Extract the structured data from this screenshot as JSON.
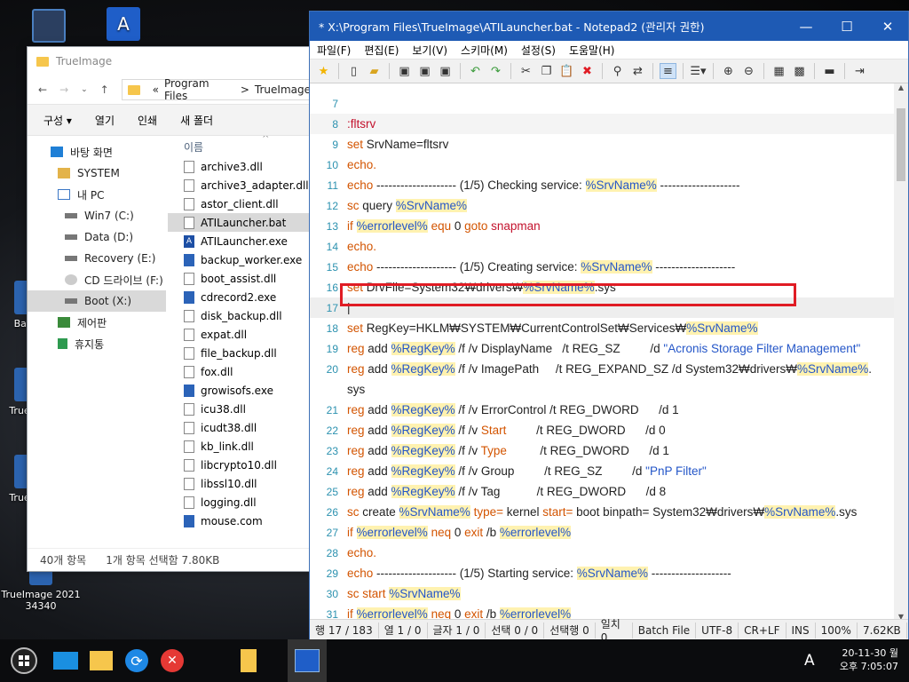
{
  "desktop": {
    "icons": [
      {
        "label": "Back"
      },
      {
        "label": "TrueIm"
      },
      {
        "label": "TrueIm"
      },
      {
        "label": "TrueImage 2021\n34340"
      }
    ]
  },
  "explorer": {
    "title": "TrueImage",
    "address": {
      "sep": "«",
      "path1": "Program Files",
      "arrow": ">",
      "path2": "TrueImage"
    },
    "commands": [
      "구성 ▾",
      "열기",
      "인쇄",
      "새 폴더"
    ],
    "nav": [
      {
        "label": "바탕 화면",
        "icon": "desktop-icon"
      },
      {
        "label": "SYSTEM",
        "icon": "user-folder-icon"
      },
      {
        "label": "내 PC",
        "icon": "computer-icon"
      },
      {
        "label": "Win7 (C:)",
        "icon": "drive-icon"
      },
      {
        "label": "Data (D:)",
        "icon": "drive-icon"
      },
      {
        "label": "Recovery (E:)",
        "icon": "drive-icon"
      },
      {
        "label": "CD 드라이브 (F:)",
        "icon": "cd-icon"
      },
      {
        "label": "Boot (X:)",
        "icon": "drive-icon"
      },
      {
        "label": "제어판",
        "icon": "control-panel-icon"
      },
      {
        "label": "휴지통",
        "icon": "recycle-bin-icon"
      }
    ],
    "column_header": "이름",
    "files": [
      "archive3.dll",
      "archive3_adapter.dll",
      "astor_client.dll",
      "ATILauncher.bat",
      "ATILauncher.exe",
      "backup_worker.exe",
      "boot_assist.dll",
      "cdrecord2.exe",
      "disk_backup.dll",
      "expat.dll",
      "file_backup.dll",
      "fox.dll",
      "growisofs.exe",
      "icu38.dll",
      "icudt38.dll",
      "kb_link.dll",
      "libcrypto10.dll",
      "libssl10.dll",
      "logging.dll",
      "mouse.com"
    ],
    "status_count": "40개 항목",
    "status_sel": "1개 항목 선택함 7.80KB"
  },
  "notepad": {
    "title": "* X:\\Program Files\\TrueImage\\ATILauncher.bat - Notepad2 (관리자 권한)",
    "menu": [
      "파일(F)",
      "편집(E)",
      "보기(V)",
      "스키마(M)",
      "설정(S)",
      "도움말(H)"
    ],
    "status": [
      "행 17 / 183",
      "열 1 / 0",
      "글자 1 / 0",
      "선택 0 / 0",
      "선택행 0",
      "일치 0",
      "Batch File",
      "UTF-8",
      "CR+LF",
      "INS",
      "100%",
      "7.62KB"
    ]
  },
  "colors": {
    "titlebar": "#1e5ab4",
    "highlight_box": "#e01c24",
    "keyword": "#d35400",
    "variable_bg": "#fff2b0"
  },
  "taskbar": {
    "ime": "A",
    "date": "20-11-30 월",
    "time": "오후 7:05:07"
  }
}
